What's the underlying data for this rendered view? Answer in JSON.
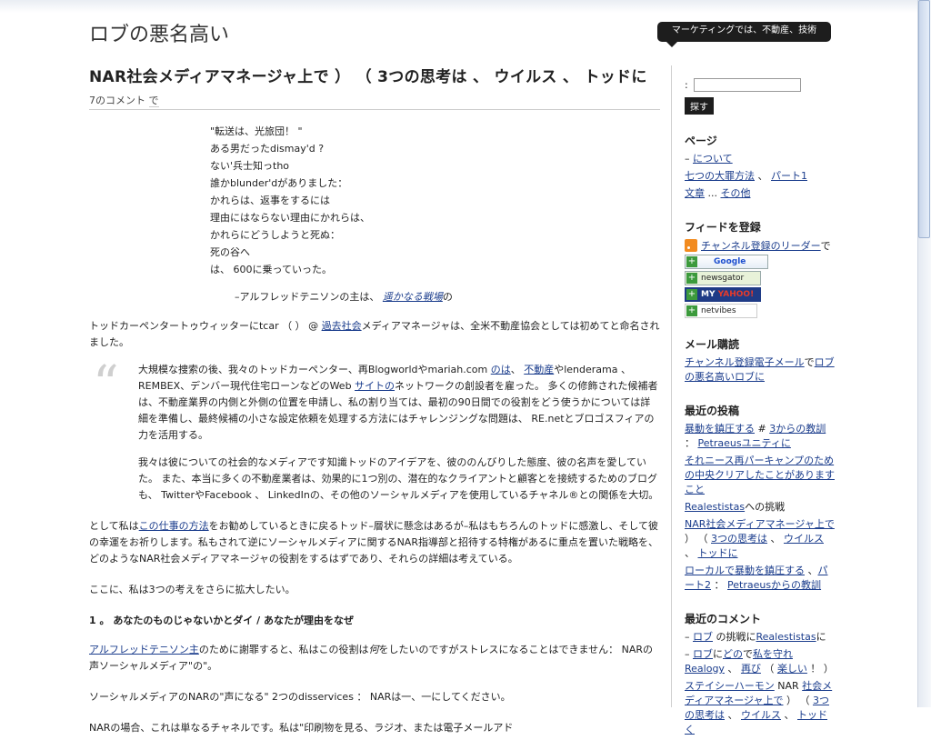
{
  "site": {
    "title": "ロブの悪名高い",
    "tagline": "マーケティングでは、不動産、技術"
  },
  "post": {
    "title": "NAR社会メディアマネージャ上で ） （ 3つの思考は 、 ウイルス 、 トッドに",
    "comments": "7のコメント",
    "by": "で",
    "poem": [
      "\"転送は、光旅団！ \"",
      "ある男だったdismay'd ?",
      "ない'兵士知っtho",
      "誰かblunder'dがありました：",
      "かれらは、返事をするには",
      "理由にはならない理由にかれらは、",
      "かれらにどうしようと死ぬ：",
      "死の谷へ",
      "は、 600に乗っていった。"
    ],
    "cite_pre": "–アルフレッドテニソンの主は、 ",
    "cite_link": "遥かなる戦場",
    "cite_post": "の",
    "p1": {
      "a": "トッドカーペンタートゥウィッターにtcar （ ） @ ",
      "link": "過去社会",
      "b": "メディアマネージャは、全米不動産協会としては初めてと命名されました。"
    },
    "quote1": {
      "a": "大規模な捜索の後、我々のトッドカーペンター、再Blogworldやmariah.com ",
      "l1": "のは",
      "b": "、 ",
      "l2": "不動産",
      "c": "やlenderama 、 REMBEX、デンバー現代住宅ローンなどのWeb ",
      "l3": "サイトの",
      "d": "ネットワークの創設者を雇った。 多くの修飾された候補者は、不動産業界の内側と外側の位置を申請し、私の割り当ては、最初の90日間での役割をどう使うかについては詳細を準備し、最終候補の小さな設定依頼を処理する方法にはチャレンジングな問題は、 RE.netとブロゴスフィアの力を活用する。"
    },
    "quote2": "我々は彼についての社会的なメディアです知識トッドのアイデアを、彼ののんびりした態度、彼の名声を愛していた。 また、本当に多くの不動産業者は、効果的に1つ別の、潜在的なクライアントと顧客とを接続するためのブログも、 TwitterやFacebook 、 LinkedInの、その他のソーシャルメディアを使用しているチャネル®との関係を大切。",
    "p2": {
      "a": "として私は",
      "link": "この仕事の方法",
      "b": "をお勧めしているときに戻るトッド–層状に懸念はあるが–私はもちろんのトッドに感激し、そして彼の幸運をお祈りします。私もされて逆にソーシャルメディアに関するNAR指導部と招待する特権があるに重点を置いた戦略を、どのようなNAR社会メディアマネージャの役割をするはずであり、それらの詳細は考えている。"
    },
    "p3": "ここに、私は3つの考えをさらに拡大したい。",
    "heading1": "1 。 あなたのものじゃないかとダイ / あなたが理由をなぜ",
    "p4": {
      "link": "アルフレッドテニソン主",
      "a": "のために謝罪すると、私はこの役割は",
      "em": "何",
      "b": "をしたいのですがストレスになることはできません： NARの声ソーシャルメディア\"の\"。"
    },
    "p5": "ソーシャルメディアのNARの\"声になる\" 2つのdisservices ： NARは一、一にしてください。",
    "p6": "NARの場合、これは単なるチャネルです。私は\"印刷物を見る、ラジオ、または電子メールアド"
  },
  "sidebar": {
    "search_label": ":",
    "search_value": "",
    "search_button": "探す",
    "pages_title": "ページ",
    "pages": {
      "p1_pre": "– ",
      "p1_link": "について",
      "p2_link": "七つの大罪方法",
      "p2_sep": " 、 ",
      "p2_link2": "パート1",
      "p3_link": "文章",
      "p3_sep": " ... ",
      "p3_link2": "その他"
    },
    "feed_title": "フィードを登録",
    "feed_link": "チャンネル登録のリーダー",
    "feed_suffix": "で",
    "badges": {
      "google": "Google",
      "newsgator": "newsgator",
      "yahoo_a": "MY ",
      "yahoo_b": "YAHOO!",
      "netvibes": "netvibes"
    },
    "mail_title": "メール購読",
    "mail_link": "チャンネル登録電子メール",
    "mail_mid": "で",
    "mail_link2": "ロブの悪名高いロブに",
    "recent_title": "最近の投稿",
    "recent": {
      "r1_link": "暴動を鎮圧する",
      "r1_sep": " # ",
      "r1_link2": "3からの教訓",
      "r1_sep2": " ： ",
      "r1_link3": "Petraeusユニティに",
      "r2": "それニース再パーキャンプのための中央クリアしたことがありますこと",
      "r3_link": "Realestistas",
      "r3_rest": "への挑戦",
      "r4_link": "NAR社会メディアマネージャ上で",
      "r4_sep": " ） （ ",
      "r4_link2": "3つの思考は",
      "r4_sep2": " 、 ",
      "r4_link3": "ウイルス",
      "r4_sep3": " 、 ",
      "r4_link4": "トッドに",
      "r5_link": "ローカルで暴動を鎮圧する",
      "r5_sep": " 、",
      "r5_link2": "パート2",
      "r5_sep2": " ： ",
      "r5_link3": "Petraeusからの教訓"
    },
    "comments_title": "最近のコメント",
    "comments": {
      "c1_pre": "– ",
      "c1_link": "ロブ",
      "c1_mid": " の挑戦に",
      "c1_link2": "Realestistas",
      "c1_post": "に",
      "c2_pre": "– ",
      "c2_link": "ロブ",
      "c2_mid": "に",
      "c2_link2": "どの",
      "c2_mid2": "で",
      "c2_link3": "私を守れ",
      "c2_link4": "Realogy",
      "c2_sep": " 、 ",
      "c2_link5": "再び",
      "c2_sep2": " （ ",
      "c2_link6": "楽しい",
      "c2_post": " ！ ）",
      "c3_link": "ステイシーハーモン",
      "c3_mid": " NAR ",
      "c3_link2": "社会メディアマネージャ上で",
      "c3_sep": " ） （ ",
      "c3_link3": "3つの思考は",
      "c3_sep2": " 、 ",
      "c3_link4": "ウイルス",
      "c3_sep3": " 、 ",
      "c3_link5": "トッドく"
    }
  }
}
